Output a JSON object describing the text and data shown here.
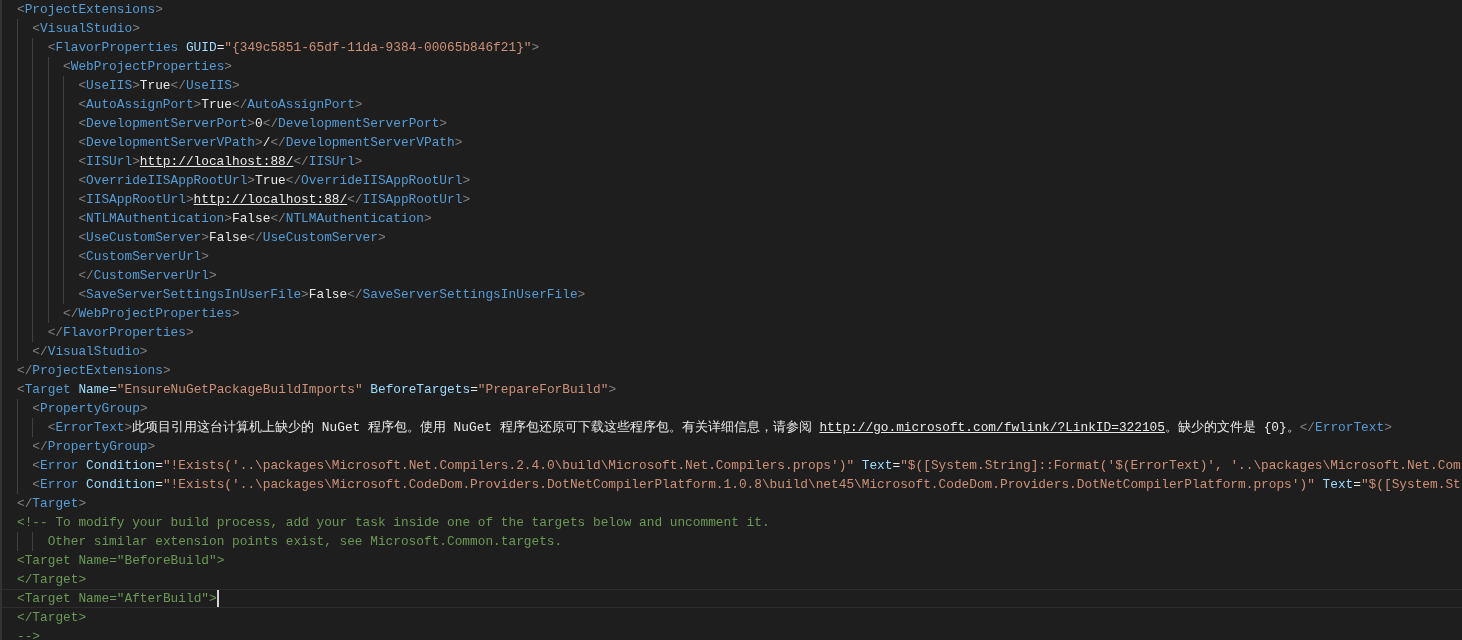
{
  "editor": {
    "lines": [
      {
        "current": false,
        "tokens": [
          {
            "kind": "punct",
            "text": "<"
          },
          {
            "kind": "tag",
            "text": "ProjectExtensions"
          },
          {
            "kind": "punct",
            "text": ">"
          }
        ],
        "children": [
          {
            "current": false,
            "tokens": [
              {
                "kind": "punct",
                "text": "<"
              },
              {
                "kind": "tag",
                "text": "VisualStudio"
              },
              {
                "kind": "punct",
                "text": ">"
              }
            ],
            "children": [
              {
                "current": false,
                "tokens": [
                  {
                    "kind": "punct",
                    "text": "<"
                  },
                  {
                    "kind": "tag",
                    "text": "FlavorProperties"
                  },
                  {
                    "kind": "attr",
                    "text": " GUID"
                  },
                  {
                    "kind": "text",
                    "text": "="
                  },
                  {
                    "kind": "string",
                    "text": "\"{349c5851-65df-11da-9384-00065b846f21}\""
                  },
                  {
                    "kind": "punct",
                    "text": ">"
                  }
                ],
                "children": [
                  {
                    "current": false,
                    "tokens": [
                      {
                        "kind": "punct",
                        "text": "<"
                      },
                      {
                        "kind": "tag",
                        "text": "WebProjectProperties"
                      },
                      {
                        "kind": "punct",
                        "text": ">"
                      }
                    ],
                    "children": [
                      {
                        "current": false,
                        "tokens": [
                          {
                            "kind": "punct",
                            "text": "<"
                          },
                          {
                            "kind": "tag",
                            "text": "UseIIS"
                          },
                          {
                            "kind": "punct",
                            "text": ">"
                          },
                          {
                            "kind": "text",
                            "text": "True"
                          },
                          {
                            "kind": "punct",
                            "text": "</"
                          },
                          {
                            "kind": "tag",
                            "text": "UseIIS"
                          },
                          {
                            "kind": "punct",
                            "text": ">"
                          }
                        ]
                      },
                      {
                        "current": false,
                        "tokens": [
                          {
                            "kind": "punct",
                            "text": "<"
                          },
                          {
                            "kind": "tag",
                            "text": "AutoAssignPort"
                          },
                          {
                            "kind": "punct",
                            "text": ">"
                          },
                          {
                            "kind": "text",
                            "text": "True"
                          },
                          {
                            "kind": "punct",
                            "text": "</"
                          },
                          {
                            "kind": "tag",
                            "text": "AutoAssignPort"
                          },
                          {
                            "kind": "punct",
                            "text": ">"
                          }
                        ]
                      },
                      {
                        "current": false,
                        "tokens": [
                          {
                            "kind": "punct",
                            "text": "<"
                          },
                          {
                            "kind": "tag",
                            "text": "DevelopmentServerPort"
                          },
                          {
                            "kind": "punct",
                            "text": ">"
                          },
                          {
                            "kind": "text",
                            "text": "0"
                          },
                          {
                            "kind": "punct",
                            "text": "</"
                          },
                          {
                            "kind": "tag",
                            "text": "DevelopmentServerPort"
                          },
                          {
                            "kind": "punct",
                            "text": ">"
                          }
                        ]
                      },
                      {
                        "current": false,
                        "tokens": [
                          {
                            "kind": "punct",
                            "text": "<"
                          },
                          {
                            "kind": "tag",
                            "text": "DevelopmentServerVPath"
                          },
                          {
                            "kind": "punct",
                            "text": ">"
                          },
                          {
                            "kind": "text",
                            "text": "/"
                          },
                          {
                            "kind": "punct",
                            "text": "</"
                          },
                          {
                            "kind": "tag",
                            "text": "DevelopmentServerVPath"
                          },
                          {
                            "kind": "punct",
                            "text": ">"
                          }
                        ]
                      },
                      {
                        "current": false,
                        "tokens": [
                          {
                            "kind": "punct",
                            "text": "<"
                          },
                          {
                            "kind": "tag",
                            "text": "IISUrl"
                          },
                          {
                            "kind": "punct",
                            "text": ">"
                          },
                          {
                            "kind": "link",
                            "text": "http://localhost:88/"
                          },
                          {
                            "kind": "punct",
                            "text": "</"
                          },
                          {
                            "kind": "tag",
                            "text": "IISUrl"
                          },
                          {
                            "kind": "punct",
                            "text": ">"
                          }
                        ]
                      },
                      {
                        "current": false,
                        "tokens": [
                          {
                            "kind": "punct",
                            "text": "<"
                          },
                          {
                            "kind": "tag",
                            "text": "OverrideIISAppRootUrl"
                          },
                          {
                            "kind": "punct",
                            "text": ">"
                          },
                          {
                            "kind": "text",
                            "text": "True"
                          },
                          {
                            "kind": "punct",
                            "text": "</"
                          },
                          {
                            "kind": "tag",
                            "text": "OverrideIISAppRootUrl"
                          },
                          {
                            "kind": "punct",
                            "text": ">"
                          }
                        ]
                      },
                      {
                        "current": false,
                        "tokens": [
                          {
                            "kind": "punct",
                            "text": "<"
                          },
                          {
                            "kind": "tag",
                            "text": "IISAppRootUrl"
                          },
                          {
                            "kind": "punct",
                            "text": ">"
                          },
                          {
                            "kind": "link",
                            "text": "http://localhost:88/"
                          },
                          {
                            "kind": "punct",
                            "text": "</"
                          },
                          {
                            "kind": "tag",
                            "text": "IISAppRootUrl"
                          },
                          {
                            "kind": "punct",
                            "text": ">"
                          }
                        ]
                      },
                      {
                        "current": false,
                        "tokens": [
                          {
                            "kind": "punct",
                            "text": "<"
                          },
                          {
                            "kind": "tag",
                            "text": "NTLMAuthentication"
                          },
                          {
                            "kind": "punct",
                            "text": ">"
                          },
                          {
                            "kind": "text",
                            "text": "False"
                          },
                          {
                            "kind": "punct",
                            "text": "</"
                          },
                          {
                            "kind": "tag",
                            "text": "NTLMAuthentication"
                          },
                          {
                            "kind": "punct",
                            "text": ">"
                          }
                        ]
                      },
                      {
                        "current": false,
                        "tokens": [
                          {
                            "kind": "punct",
                            "text": "<"
                          },
                          {
                            "kind": "tag",
                            "text": "UseCustomServer"
                          },
                          {
                            "kind": "punct",
                            "text": ">"
                          },
                          {
                            "kind": "text",
                            "text": "False"
                          },
                          {
                            "kind": "punct",
                            "text": "</"
                          },
                          {
                            "kind": "tag",
                            "text": "UseCustomServer"
                          },
                          {
                            "kind": "punct",
                            "text": ">"
                          }
                        ]
                      },
                      {
                        "current": false,
                        "tokens": [
                          {
                            "kind": "punct",
                            "text": "<"
                          },
                          {
                            "kind": "tag",
                            "text": "CustomServerUrl"
                          },
                          {
                            "kind": "punct",
                            "text": ">"
                          }
                        ]
                      },
                      {
                        "current": false,
                        "tokens": [
                          {
                            "kind": "punct",
                            "text": "</"
                          },
                          {
                            "kind": "tag",
                            "text": "CustomServerUrl"
                          },
                          {
                            "kind": "punct",
                            "text": ">"
                          }
                        ]
                      },
                      {
                        "current": false,
                        "tokens": [
                          {
                            "kind": "punct",
                            "text": "<"
                          },
                          {
                            "kind": "tag",
                            "text": "SaveServerSettingsInUserFile"
                          },
                          {
                            "kind": "punct",
                            "text": ">"
                          },
                          {
                            "kind": "text",
                            "text": "False"
                          },
                          {
                            "kind": "punct",
                            "text": "</"
                          },
                          {
                            "kind": "tag",
                            "text": "SaveServerSettingsInUserFile"
                          },
                          {
                            "kind": "punct",
                            "text": ">"
                          }
                        ]
                      }
                    ]
                  },
                  {
                    "current": false,
                    "tokens": [
                      {
                        "kind": "punct",
                        "text": "</"
                      },
                      {
                        "kind": "tag",
                        "text": "WebProjectProperties"
                      },
                      {
                        "kind": "punct",
                        "text": ">"
                      }
                    ]
                  }
                ]
              },
              {
                "current": false,
                "tokens": [
                  {
                    "kind": "punct",
                    "text": "</"
                  },
                  {
                    "kind": "tag",
                    "text": "FlavorProperties"
                  },
                  {
                    "kind": "punct",
                    "text": ">"
                  }
                ]
              }
            ]
          },
          {
            "current": false,
            "tokens": [
              {
                "kind": "punct",
                "text": "</"
              },
              {
                "kind": "tag",
                "text": "VisualStudio"
              },
              {
                "kind": "punct",
                "text": ">"
              }
            ]
          }
        ]
      },
      {
        "current": false,
        "tokens": [
          {
            "kind": "punct",
            "text": "</"
          },
          {
            "kind": "tag",
            "text": "ProjectExtensions"
          },
          {
            "kind": "punct",
            "text": ">"
          }
        ]
      },
      {
        "current": false,
        "tokens": [
          {
            "kind": "punct",
            "text": "<"
          },
          {
            "kind": "tag",
            "text": "Target"
          },
          {
            "kind": "attr",
            "text": " Name"
          },
          {
            "kind": "text",
            "text": "="
          },
          {
            "kind": "string",
            "text": "\"EnsureNuGetPackageBuildImports\""
          },
          {
            "kind": "attr",
            "text": " BeforeTargets"
          },
          {
            "kind": "text",
            "text": "="
          },
          {
            "kind": "string",
            "text": "\"PrepareForBuild\""
          },
          {
            "kind": "punct",
            "text": ">"
          }
        ],
        "children": [
          {
            "current": false,
            "tokens": [
              {
                "kind": "punct",
                "text": "<"
              },
              {
                "kind": "tag",
                "text": "PropertyGroup"
              },
              {
                "kind": "punct",
                "text": ">"
              }
            ],
            "children": [
              {
                "current": false,
                "tokens": [
                  {
                    "kind": "punct",
                    "text": "<"
                  },
                  {
                    "kind": "tag",
                    "text": "ErrorText"
                  },
                  {
                    "kind": "punct",
                    "text": ">"
                  },
                  {
                    "kind": "text",
                    "text": "此项目引用这台计算机上缺少的 NuGet 程序包。使用 NuGet 程序包还原可下载这些程序包。有关详细信息，请参阅 "
                  },
                  {
                    "kind": "link",
                    "text": "http://go.microsoft.com/fwlink/?LinkID=322105"
                  },
                  {
                    "kind": "text",
                    "text": "。缺少的文件是 {0}。"
                  },
                  {
                    "kind": "punct",
                    "text": "</"
                  },
                  {
                    "kind": "tag",
                    "text": "ErrorText"
                  },
                  {
                    "kind": "punct",
                    "text": ">"
                  }
                ]
              }
            ]
          },
          {
            "current": false,
            "tokens": [
              {
                "kind": "punct",
                "text": "</"
              },
              {
                "kind": "tag",
                "text": "PropertyGroup"
              },
              {
                "kind": "punct",
                "text": ">"
              }
            ]
          },
          {
            "current": false,
            "tokens": [
              {
                "kind": "punct",
                "text": "<"
              },
              {
                "kind": "tag",
                "text": "Error"
              },
              {
                "kind": "attr",
                "text": " Condition"
              },
              {
                "kind": "text",
                "text": "="
              },
              {
                "kind": "string",
                "text": "\"!Exists('..\\packages\\Microsoft.Net.Compilers.2.4.0\\build\\Microsoft.Net.Compilers.props')\""
              },
              {
                "kind": "attr",
                "text": " Text"
              },
              {
                "kind": "text",
                "text": "="
              },
              {
                "kind": "string",
                "text": "\"$([System.String]::Format('$(ErrorText)', '..\\packages\\Microsoft.Net.Com"
              }
            ]
          },
          {
            "current": false,
            "tokens": [
              {
                "kind": "punct",
                "text": "<"
              },
              {
                "kind": "tag",
                "text": "Error"
              },
              {
                "kind": "attr",
                "text": " Condition"
              },
              {
                "kind": "text",
                "text": "="
              },
              {
                "kind": "string",
                "text": "\"!Exists('..\\packages\\Microsoft.CodeDom.Providers.DotNetCompilerPlatform.1.0.8\\build\\net45\\Microsoft.CodeDom.Providers.DotNetCompilerPlatform.props')\""
              },
              {
                "kind": "attr",
                "text": " Text"
              },
              {
                "kind": "text",
                "text": "="
              },
              {
                "kind": "string",
                "text": "\"$([System.St"
              }
            ]
          }
        ]
      },
      {
        "current": false,
        "tokens": [
          {
            "kind": "punct",
            "text": "</"
          },
          {
            "kind": "tag",
            "text": "Target"
          },
          {
            "kind": "punct",
            "text": ">"
          }
        ]
      },
      {
        "current": false,
        "tokens": [
          {
            "kind": "comment",
            "text": "<!-- To modify your build process, add your task inside one of the targets below and uncomment it."
          }
        ],
        "children": [
          {
            "children": [
              {
                "current": false,
                "tokens": [
                  {
                    "kind": "comment",
                    "text": "Other similar extension points exist, see Microsoft.Common.targets."
                  }
                ]
              }
            ]
          }
        ]
      },
      {
        "current": false,
        "tokens": [
          {
            "kind": "comment",
            "text": "<Target Name=\"BeforeBuild\">"
          }
        ]
      },
      {
        "current": false,
        "tokens": [
          {
            "kind": "comment",
            "text": "</Target>"
          }
        ]
      },
      {
        "current": true,
        "tokens": [
          {
            "kind": "comment",
            "text": "<Target Name=\"AfterBuild\">"
          }
        ]
      },
      {
        "current": false,
        "tokens": [
          {
            "kind": "comment",
            "text": "</Target>"
          }
        ]
      },
      {
        "current": false,
        "tokens": [
          {
            "kind": "comment",
            "text": "-->"
          }
        ]
      }
    ]
  }
}
